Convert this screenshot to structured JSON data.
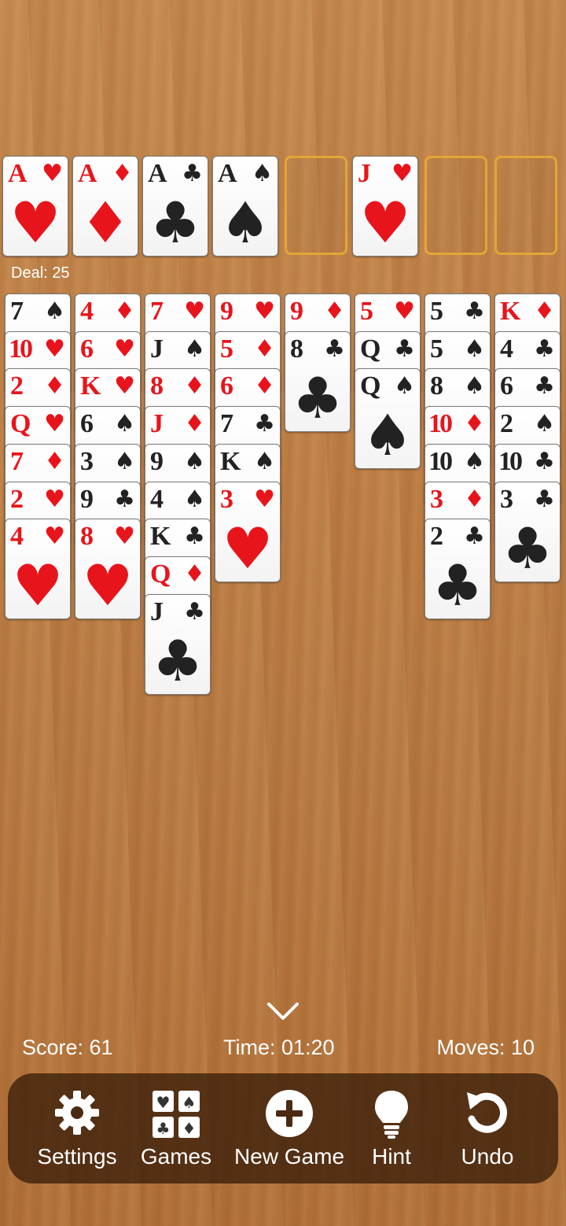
{
  "top_row": [
    {
      "rank": "A",
      "suit": "♥",
      "color": "red"
    },
    {
      "rank": "A",
      "suit": "♦",
      "color": "red"
    },
    {
      "rank": "A",
      "suit": "♣",
      "color": "black"
    },
    {
      "rank": "A",
      "suit": "♠",
      "color": "black"
    },
    null,
    {
      "rank": "J",
      "suit": "♥",
      "color": "red"
    },
    null,
    null
  ],
  "deal_label": "Deal: 25",
  "tableau": [
    [
      {
        "rank": "7",
        "suit": "♠",
        "color": "black"
      },
      {
        "rank": "10",
        "suit": "♥",
        "color": "red"
      },
      {
        "rank": "2",
        "suit": "♦",
        "color": "red"
      },
      {
        "rank": "Q",
        "suit": "♥",
        "color": "red"
      },
      {
        "rank": "7",
        "suit": "♦",
        "color": "red"
      },
      {
        "rank": "2",
        "suit": "♥",
        "color": "red"
      },
      {
        "rank": "4",
        "suit": "♥",
        "color": "red"
      }
    ],
    [
      {
        "rank": "4",
        "suit": "♦",
        "color": "red"
      },
      {
        "rank": "6",
        "suit": "♥",
        "color": "red"
      },
      {
        "rank": "K",
        "suit": "♥",
        "color": "red"
      },
      {
        "rank": "6",
        "suit": "♠",
        "color": "black"
      },
      {
        "rank": "3",
        "suit": "♠",
        "color": "black"
      },
      {
        "rank": "9",
        "suit": "♣",
        "color": "black"
      },
      {
        "rank": "8",
        "suit": "♥",
        "color": "red"
      }
    ],
    [
      {
        "rank": "7",
        "suit": "♥",
        "color": "red"
      },
      {
        "rank": "J",
        "suit": "♠",
        "color": "black"
      },
      {
        "rank": "8",
        "suit": "♦",
        "color": "red"
      },
      {
        "rank": "J",
        "suit": "♦",
        "color": "red"
      },
      {
        "rank": "9",
        "suit": "♠",
        "color": "black"
      },
      {
        "rank": "4",
        "suit": "♠",
        "color": "black"
      },
      {
        "rank": "K",
        "suit": "♣",
        "color": "black"
      },
      {
        "rank": "Q",
        "suit": "♦",
        "color": "red"
      },
      {
        "rank": "J",
        "suit": "♣",
        "color": "black"
      }
    ],
    [
      {
        "rank": "9",
        "suit": "♥",
        "color": "red"
      },
      {
        "rank": "5",
        "suit": "♦",
        "color": "red"
      },
      {
        "rank": "6",
        "suit": "♦",
        "color": "red"
      },
      {
        "rank": "7",
        "suit": "♣",
        "color": "black"
      },
      {
        "rank": "K",
        "suit": "♠",
        "color": "black"
      },
      {
        "rank": "3",
        "suit": "♥",
        "color": "red"
      }
    ],
    [
      {
        "rank": "9",
        "suit": "♦",
        "color": "red"
      },
      {
        "rank": "8",
        "suit": "♣",
        "color": "black"
      }
    ],
    [
      {
        "rank": "5",
        "suit": "♥",
        "color": "red"
      },
      {
        "rank": "Q",
        "suit": "♣",
        "color": "black"
      },
      {
        "rank": "Q",
        "suit": "♠",
        "color": "black"
      }
    ],
    [
      {
        "rank": "5",
        "suit": "♣",
        "color": "black"
      },
      {
        "rank": "5",
        "suit": "♠",
        "color": "black"
      },
      {
        "rank": "8",
        "suit": "♠",
        "color": "black"
      },
      {
        "rank": "10",
        "suit": "♦",
        "color": "red"
      },
      {
        "rank": "10",
        "suit": "♠",
        "color": "black"
      },
      {
        "rank": "3",
        "suit": "♦",
        "color": "red"
      },
      {
        "rank": "2",
        "suit": "♣",
        "color": "black"
      }
    ],
    [
      {
        "rank": "K",
        "suit": "♦",
        "color": "red"
      },
      {
        "rank": "4",
        "suit": "♣",
        "color": "black"
      },
      {
        "rank": "6",
        "suit": "♣",
        "color": "black"
      },
      {
        "rank": "2",
        "suit": "♠",
        "color": "black"
      },
      {
        "rank": "10",
        "suit": "♣",
        "color": "black"
      },
      {
        "rank": "3",
        "suit": "♣",
        "color": "black"
      }
    ]
  ],
  "stats": {
    "score": "Score: 61",
    "time": "Time: 01:20",
    "moves": "Moves: 10"
  },
  "toolbar": [
    {
      "label": "Settings",
      "icon": "gear-icon"
    },
    {
      "label": "Games",
      "icon": "games-grid-icon"
    },
    {
      "label": "New Game",
      "icon": "plus-circle-icon"
    },
    {
      "label": "Hint",
      "icon": "lightbulb-icon"
    },
    {
      "label": "Undo",
      "icon": "undo-icon"
    }
  ],
  "colors": {
    "red_suit": "#e8141c",
    "black_suit": "#222222",
    "slot_outline": "#e3a636"
  }
}
